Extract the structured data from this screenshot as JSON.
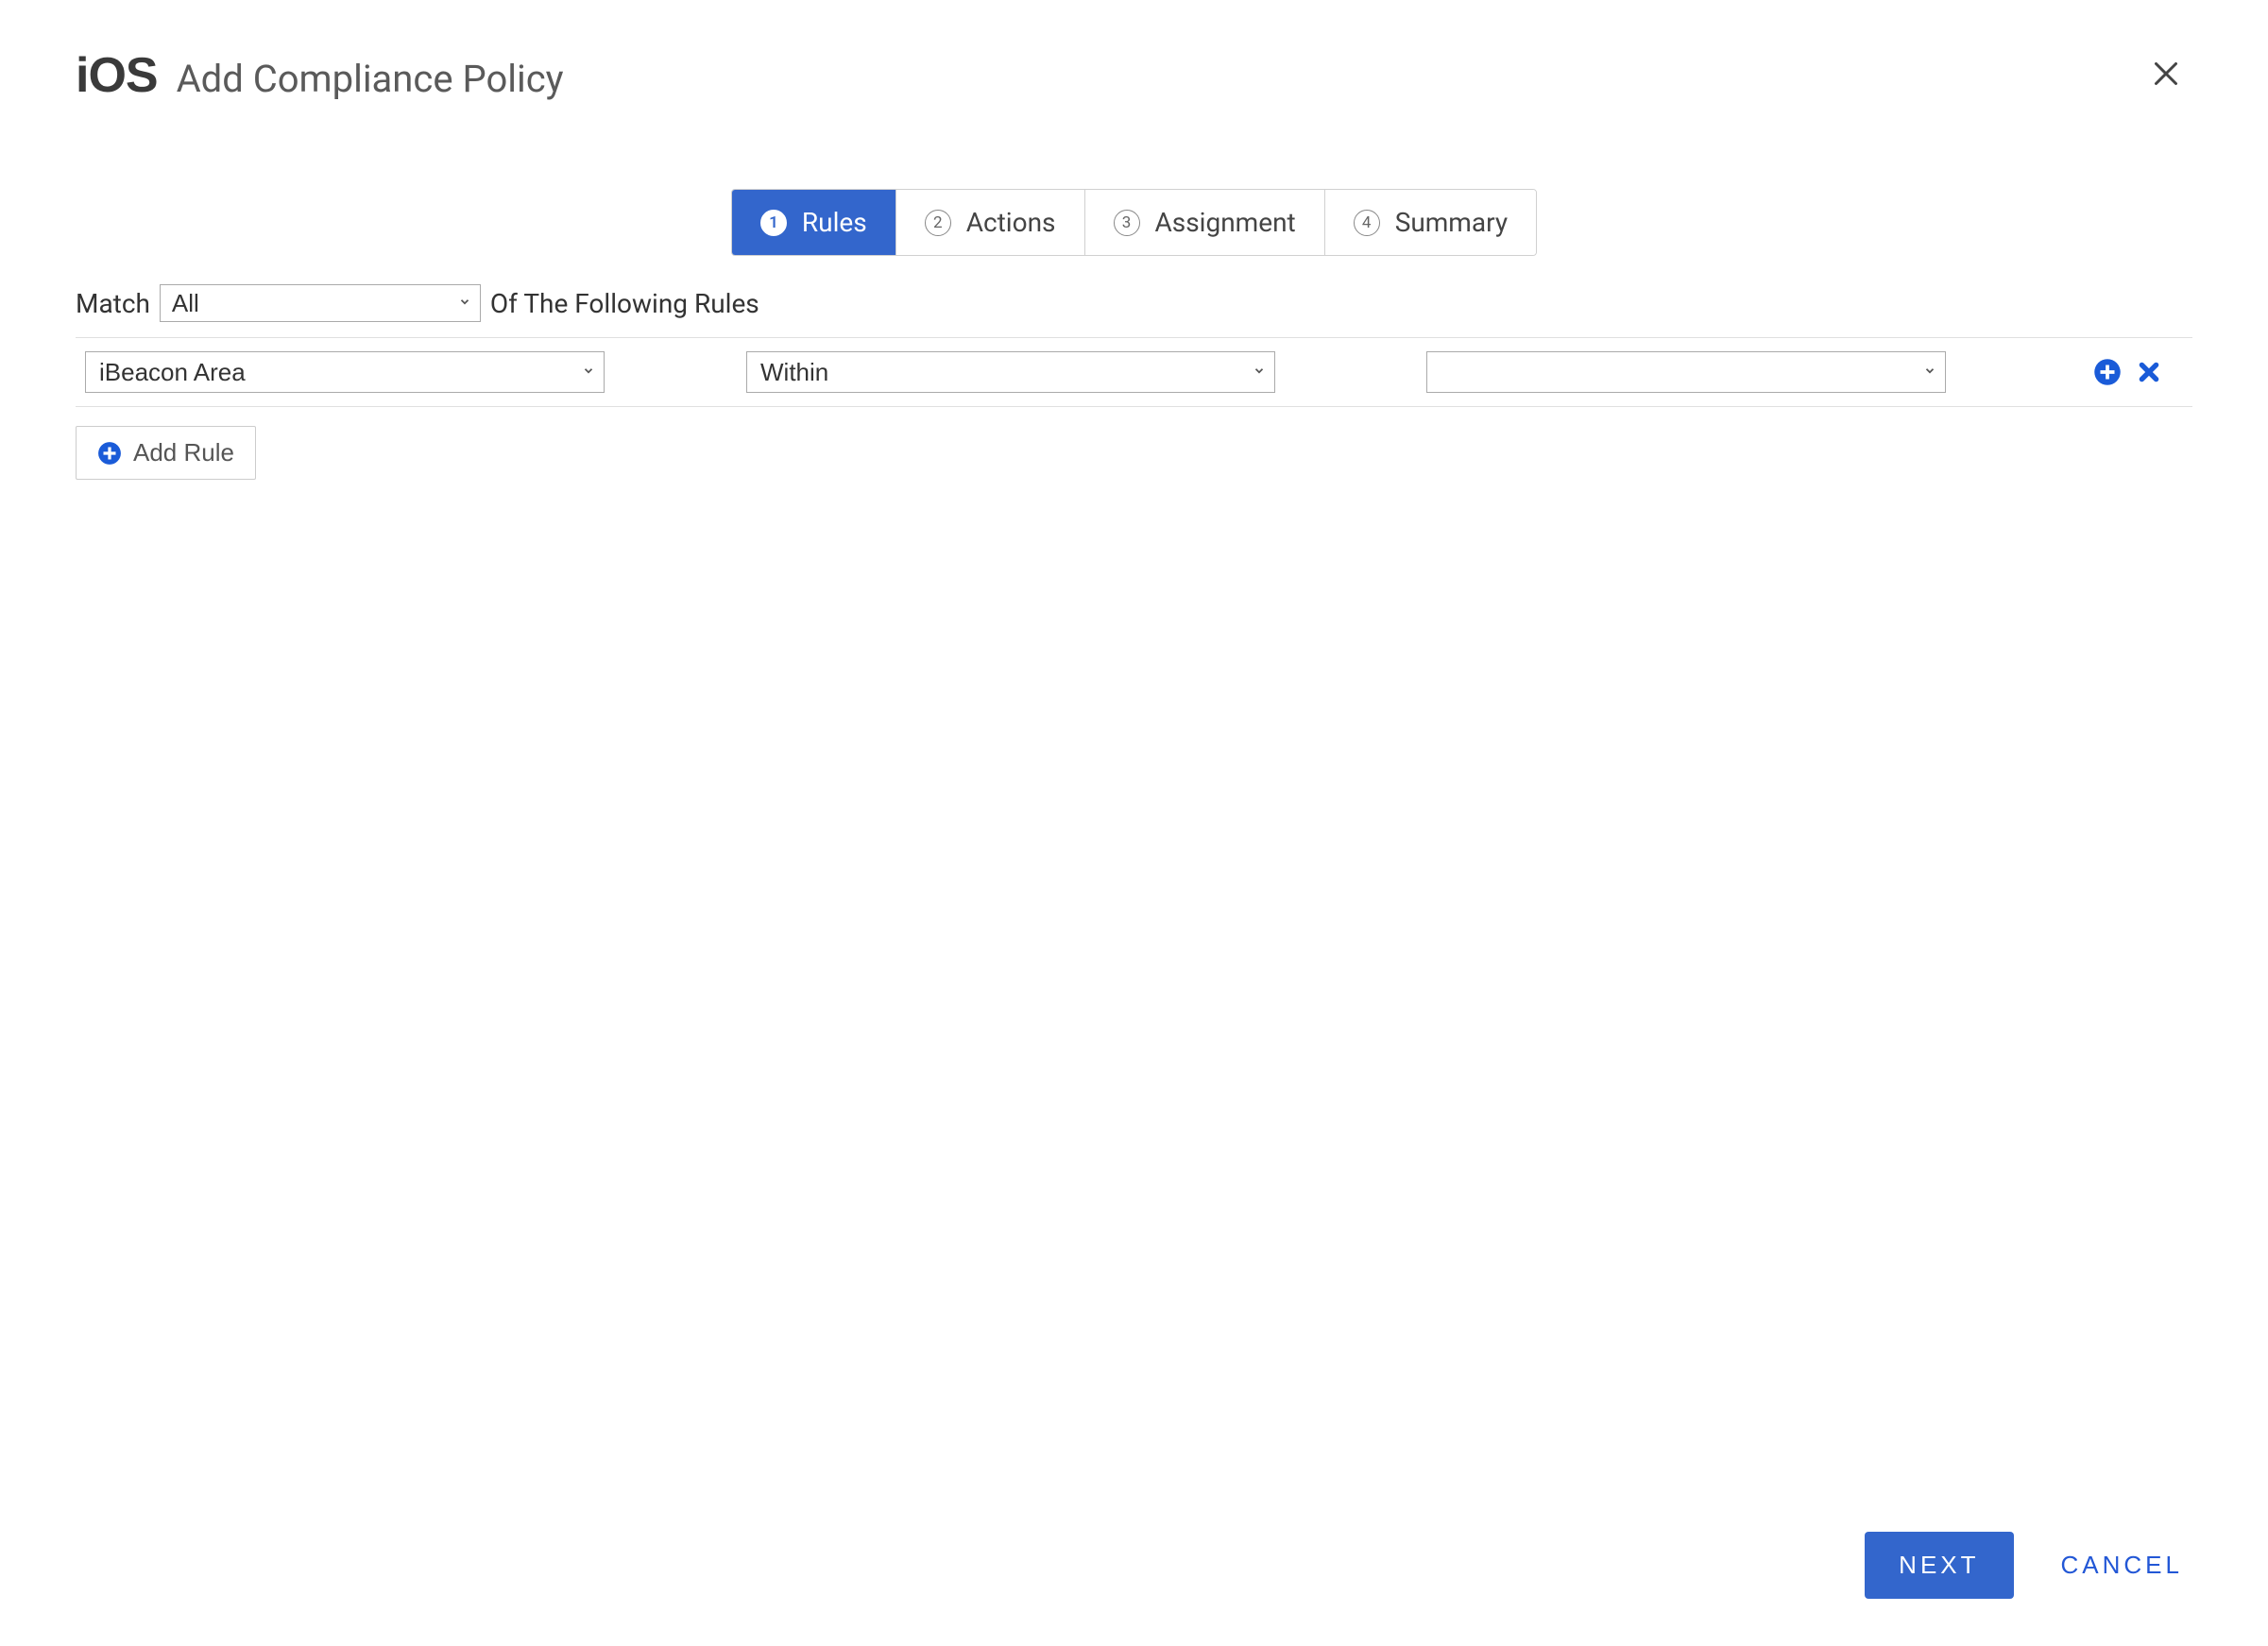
{
  "header": {
    "platform": "iOS",
    "title": "Add Compliance Policy"
  },
  "wizard": {
    "steps": [
      {
        "num": "1",
        "label": "Rules",
        "active": true
      },
      {
        "num": "2",
        "label": "Actions",
        "active": false
      },
      {
        "num": "3",
        "label": "Assignment",
        "active": false
      },
      {
        "num": "4",
        "label": "Summary",
        "active": false
      }
    ]
  },
  "match": {
    "prefix": "Match",
    "value": "All",
    "suffix": "Of The Following Rules"
  },
  "rule": {
    "field": "iBeacon Area",
    "operator": "Within",
    "value": ""
  },
  "add_rule_label": "Add Rule",
  "footer": {
    "next": "NEXT",
    "cancel": "CANCEL"
  }
}
